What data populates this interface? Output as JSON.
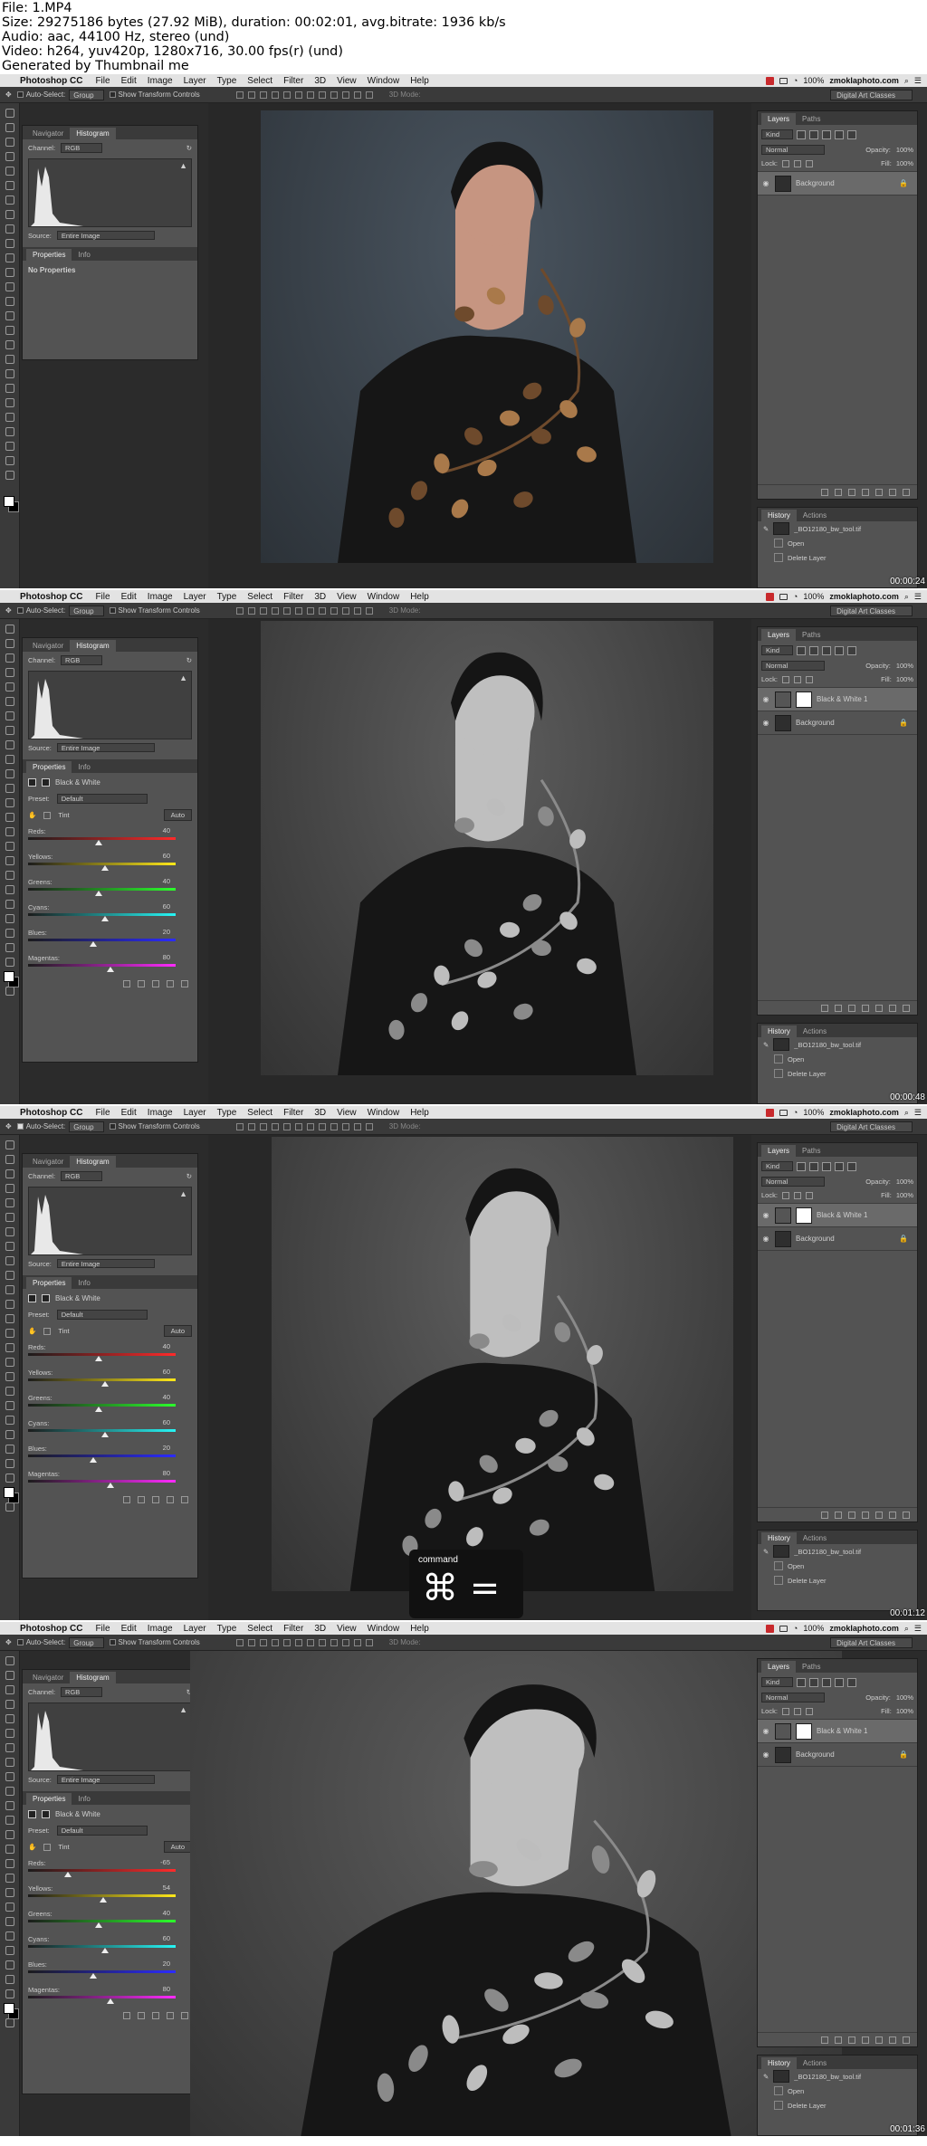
{
  "info_lines": [
    "File: 1.MP4",
    "Size: 29275186 bytes (27.92 MiB), duration: 00:02:01, avg.bitrate: 1936 kb/s",
    "Audio: aac, 44100 Hz, stereo (und)",
    "Video: h264, yuv420p, 1280x716, 30.00 fps(r) (und)",
    "Generated by Thumbnail me"
  ],
  "menu": {
    "apple": "",
    "app": "Photoshop CC",
    "items": [
      "File",
      "Edit",
      "Image",
      "Layer",
      "Type",
      "Select",
      "Filter",
      "3D",
      "View",
      "Window",
      "Help"
    ],
    "site": "zmoklaphoto.com",
    "battery": "100%"
  },
  "options": {
    "auto_select": "Auto-Select:",
    "group": "Group",
    "transform": "Show Transform Controls",
    "mode3d": "3D Mode:",
    "workspace": "Digital Art Classes"
  },
  "nav_tabs": [
    "Navigator",
    "Histogram"
  ],
  "histogram": {
    "channel_label": "Channel:",
    "channel": "RGB",
    "source_label": "Source:",
    "source": "Entire Image"
  },
  "props_tabs": [
    "Properties",
    "Info"
  ],
  "no_props": "No Properties",
  "bw": {
    "title": "Black & White",
    "preset_label": "Preset:",
    "preset": "Default",
    "tint": "Tint",
    "auto": "Auto",
    "sliders": [
      {
        "label": "Reds:",
        "value": 40,
        "grad": "linear-gradient(90deg,#1b1b1b,#ff2a2a)"
      },
      {
        "label": "Yellows:",
        "value": 60,
        "grad": "linear-gradient(90deg,#1b1b1b,#ffe81a)"
      },
      {
        "label": "Greens:",
        "value": 40,
        "grad": "linear-gradient(90deg,#1b1b1b,#2cff2c)"
      },
      {
        "label": "Cyans:",
        "value": 60,
        "grad": "linear-gradient(90deg,#1b1b1b,#26f5f5)"
      },
      {
        "label": "Blues:",
        "value": 20,
        "grad": "linear-gradient(90deg,#1b1b1b,#2b2bff)"
      },
      {
        "label": "Magentas:",
        "value": 80,
        "grad": "linear-gradient(90deg,#1b1b1b,#ff2aff)"
      }
    ],
    "sliders4": [
      {
        "label": "Reds:",
        "value": -65
      },
      {
        "label": "Yellows:",
        "value": 54
      },
      {
        "label": "Greens:",
        "value": 40
      },
      {
        "label": "Cyans:",
        "value": 60
      },
      {
        "label": "Blues:",
        "value": 20
      },
      {
        "label": "Magentas:",
        "value": 80
      }
    ]
  },
  "layers": {
    "tabs": [
      "Layers",
      "Paths"
    ],
    "kind": "Kind",
    "blend": "Normal",
    "opacity_label": "Opacity:",
    "opacity": "100%",
    "lock_label": "Lock:",
    "fill_label": "Fill:",
    "fill": "100%",
    "bw_layer": "Black & White 1",
    "bg_layer": "Background"
  },
  "history": {
    "tabs": [
      "History",
      "Actions"
    ],
    "file": "_BO12180_bw_tool.tif",
    "steps": [
      "Open",
      "Delete Layer"
    ]
  },
  "overlay": {
    "label": "command",
    "keys": "⌘ ="
  },
  "timestamps": [
    "00:00:24",
    "00:00:48",
    "00:01:12",
    "00:01:36"
  ]
}
